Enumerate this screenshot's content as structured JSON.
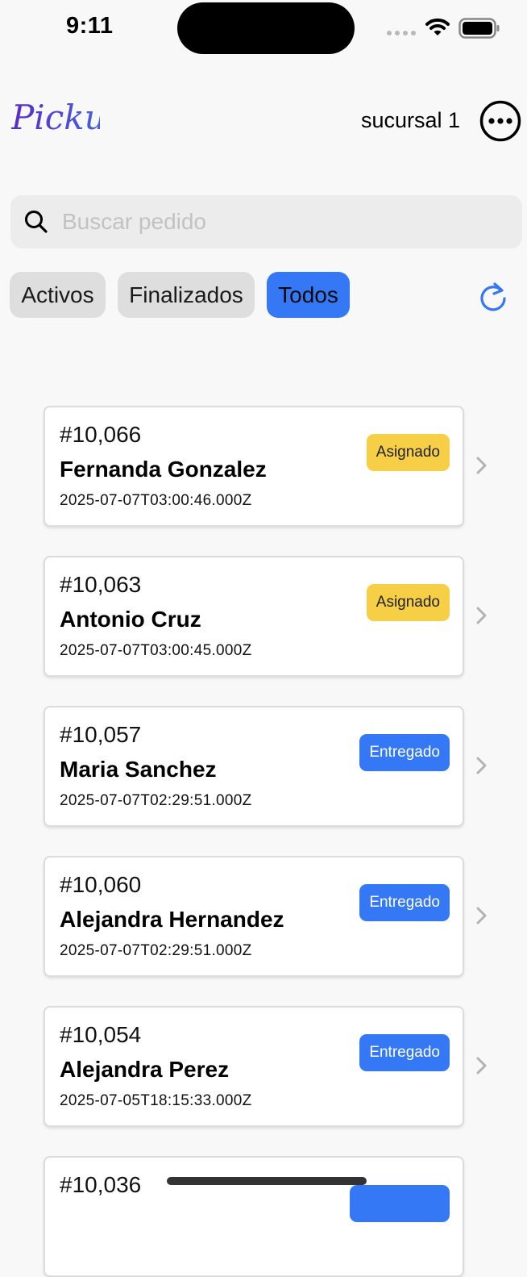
{
  "status_bar": {
    "time": "9:11"
  },
  "header": {
    "logo_text": "Pickup",
    "branch": "sucursal 1",
    "more_icon": "more-circle-icon"
  },
  "search": {
    "placeholder": "Buscar pedido",
    "value": ""
  },
  "tabs": [
    {
      "label": "Activos",
      "active": false
    },
    {
      "label": "Finalizados",
      "active": false
    },
    {
      "label": "Todos",
      "active": true
    }
  ],
  "orders": [
    {
      "number": "#10,066",
      "name": "Fernanda Gonzalez",
      "date": "2025-07-07T03:00:46.000Z",
      "status": "Asignado"
    },
    {
      "number": "#10,063",
      "name": "Antonio Cruz",
      "date": "2025-07-07T03:00:45.000Z",
      "status": "Asignado"
    },
    {
      "number": "#10,057",
      "name": "Maria Sanchez",
      "date": "2025-07-07T02:29:51.000Z",
      "status": "Entregado"
    },
    {
      "number": "#10,060",
      "name": "Alejandra Hernandez",
      "date": "2025-07-07T02:29:51.000Z",
      "status": "Entregado"
    },
    {
      "number": "#10,054",
      "name": "Alejandra Perez",
      "date": "2025-07-05T18:15:33.000Z",
      "status": "Entregado"
    },
    {
      "number": "#10,036",
      "name": "",
      "date": "",
      "status": ""
    }
  ],
  "colors": {
    "accent": "#3478f6",
    "badge_asignado": "#f6cf46",
    "badge_entregado": "#3478f6",
    "background": "#f8f8f8"
  }
}
